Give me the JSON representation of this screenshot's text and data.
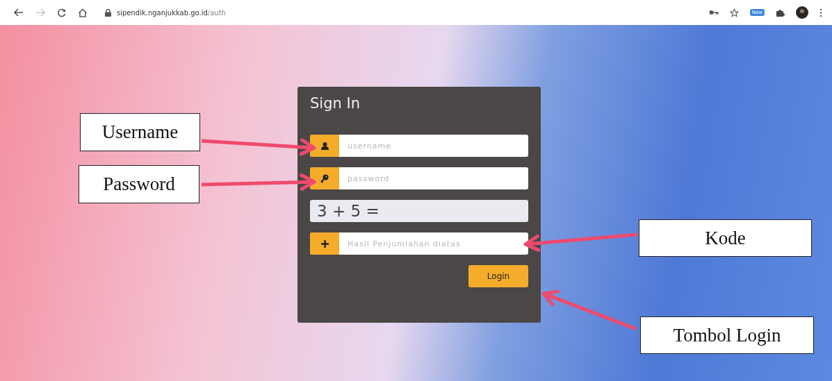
{
  "browser": {
    "url_host": "sipendik.nganjukkab.go.id",
    "url_path": "/auth",
    "extension_badge": "New"
  },
  "login_card": {
    "title": "Sign In",
    "rows": [
      {
        "kind": "username",
        "placeholder": "username"
      },
      {
        "kind": "password",
        "placeholder": "password"
      },
      {
        "kind": "captcha",
        "text": "3 + 5 ="
      },
      {
        "kind": "answer",
        "placeholder": "Hasil Penjumlahan diatas"
      }
    ],
    "button": "Login"
  },
  "annotations": [
    {
      "label": "Username"
    },
    {
      "label": "Password"
    },
    {
      "label": "Kode"
    },
    {
      "label": "Tombol Login"
    }
  ]
}
